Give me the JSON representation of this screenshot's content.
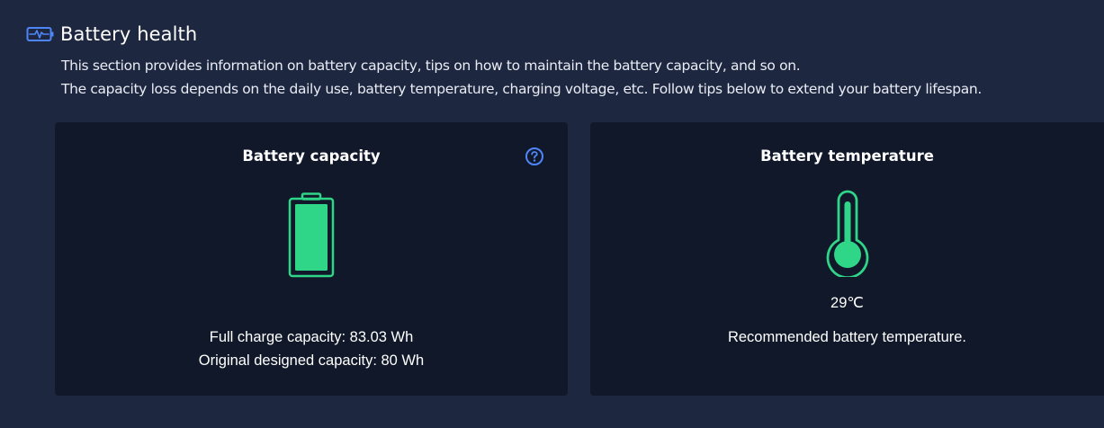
{
  "section": {
    "title": "Battery health",
    "icon": "battery-pulse-icon",
    "description_line1": "This section provides information on battery capacity, tips on how to maintain the battery capacity, and so on.",
    "description_line2": "The capacity loss depends on the daily use, battery temperature, charging voltage, etc. Follow tips below to extend your battery lifespan."
  },
  "capacity_card": {
    "title": "Battery capacity",
    "help_icon": "question-circle-icon",
    "battery_icon": "battery-full-icon",
    "full_charge": "Full charge capacity: 83.03 Wh",
    "original_designed": "Original designed capacity: 80 Wh"
  },
  "temperature_card": {
    "title": "Battery temperature",
    "thermometer_icon": "thermometer-icon",
    "value": "29℃",
    "note": "Recommended battery temperature."
  },
  "colors": {
    "background": "#1e2740",
    "card": "#10182a",
    "accent_green": "#2fd688",
    "accent_blue": "#4f86f7"
  }
}
